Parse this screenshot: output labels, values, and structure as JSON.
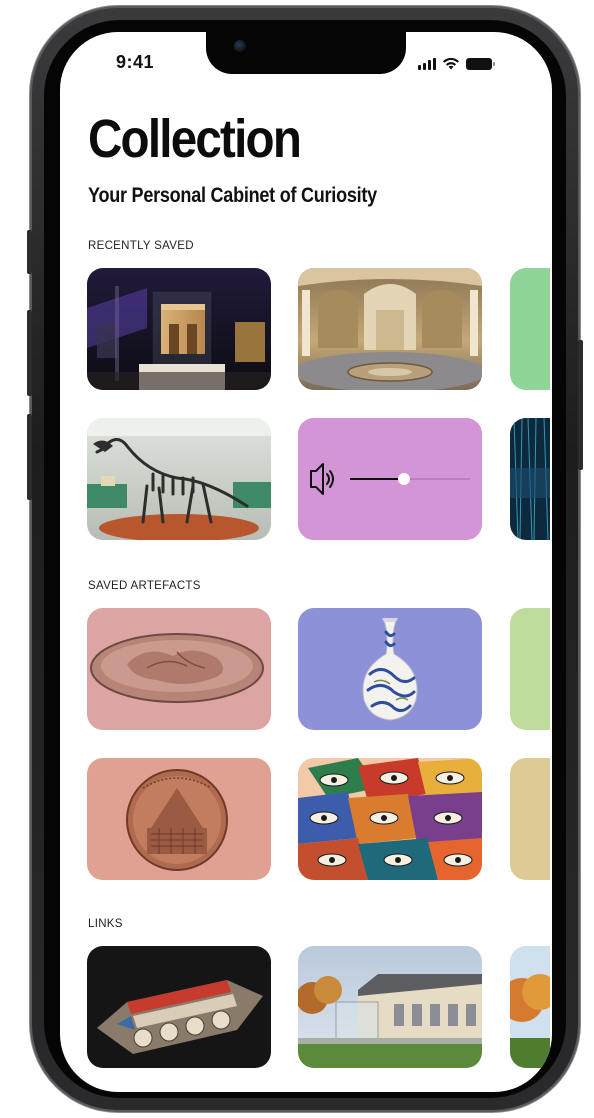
{
  "status_bar": {
    "time": "9:41"
  },
  "header": {
    "title": "Collection",
    "subtitle": "Your Personal Cabinet of Curiosity"
  },
  "sections": {
    "recently_saved": {
      "label": "RECENTLY SAVED",
      "items": [
        {
          "name": "museum-gallery-arch-photo",
          "bg": "#1a1a22"
        },
        {
          "name": "rotunda-hall-photo",
          "bg": "#b59a6a"
        },
        {
          "name": "green-tile",
          "bg": "#8fd597"
        },
        {
          "name": "dinosaur-skeleton-photo",
          "bg": "#9fa59a"
        },
        {
          "name": "audio-player-tile",
          "bg": "#d495d6",
          "volume": 0.48
        },
        {
          "name": "blue-abstract-photo",
          "bg": "#0d2a3c"
        }
      ]
    },
    "saved_artefacts": {
      "label": "SAVED ARTEFACTS",
      "items": [
        {
          "name": "bronze-plaque",
          "bg": "#dca5a4"
        },
        {
          "name": "iznik-vase",
          "bg": "#8d91d8"
        },
        {
          "name": "lime-tile",
          "bg": "#c0dc9c"
        },
        {
          "name": "medal-coin",
          "bg": "#e0a092"
        },
        {
          "name": "eyes-collage",
          "bg": "#f3c9a8"
        },
        {
          "name": "tan-tile",
          "bg": "#dccb95"
        }
      ]
    },
    "links": {
      "label": "LINKS",
      "items": [
        {
          "name": "3d-model-render",
          "bg": "#151515"
        },
        {
          "name": "museum-building-photo",
          "bg": "#c4d3e2"
        },
        {
          "name": "autumn-trees-photo",
          "bg": "#d47b2f"
        }
      ]
    }
  },
  "colors": {
    "text": "#0c0c0c",
    "background": "#ffffff"
  }
}
